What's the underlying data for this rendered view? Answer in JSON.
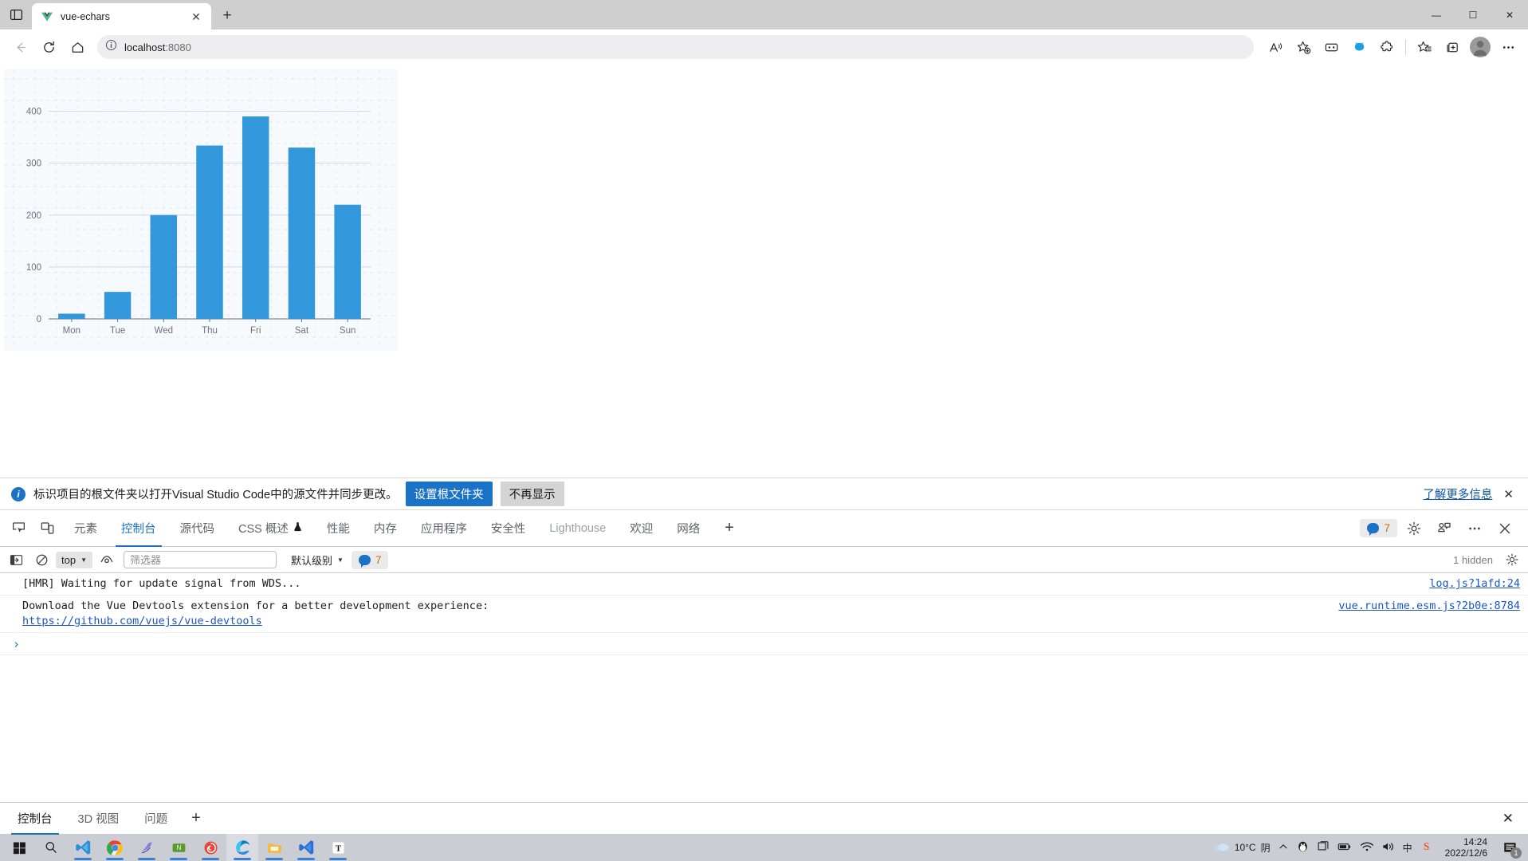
{
  "browser": {
    "tab": {
      "title": "vue-echars",
      "favicon": "vue-logo-icon",
      "close_label": "✕"
    },
    "new_tab_label": "+",
    "window_controls": {
      "minimize": "—",
      "maximize": "☐",
      "close": "✕"
    },
    "address": {
      "host": "localhost",
      "port": ":8080",
      "full": "localhost:8080"
    },
    "nav": {
      "back": "←",
      "refresh": "⟳",
      "home": "⌂"
    }
  },
  "chart_data": {
    "type": "bar",
    "title": "",
    "xlabel": "",
    "ylabel": "",
    "categories": [
      "Mon",
      "Tue",
      "Wed",
      "Thu",
      "Fri",
      "Sat",
      "Sun"
    ],
    "values": [
      10,
      52,
      200,
      334,
      390,
      330,
      220
    ],
    "ytick_labels": [
      "0",
      "100",
      "200",
      "300",
      "400"
    ],
    "yticks": [
      0,
      100,
      200,
      300,
      400
    ],
    "ylim": [
      0,
      450
    ],
    "grid": true,
    "legend": "none",
    "bar_color": "#3398db",
    "axis_color": "#333333",
    "gridline_color": "#ccdbe8",
    "selection_color": "#1fa391"
  },
  "notice": {
    "icon": "info-icon",
    "text": "标识项目的根文件夹以打开Visual Studio Code中的源文件并同步更改。",
    "primary_button": "设置根文件夹",
    "secondary_button": "不再显示",
    "learn_more": "了解更多信息",
    "close": "✕"
  },
  "devtools": {
    "tabs": [
      {
        "label": "元素",
        "active": false,
        "muted": false
      },
      {
        "label": "控制台",
        "active": true,
        "muted": false
      },
      {
        "label": "源代码",
        "active": false,
        "muted": false
      },
      {
        "label": "CSS 概述",
        "active": false,
        "muted": false,
        "badge": "flask-icon"
      },
      {
        "label": "性能",
        "active": false,
        "muted": false
      },
      {
        "label": "内存",
        "active": false,
        "muted": false
      },
      {
        "label": "应用程序",
        "active": false,
        "muted": false
      },
      {
        "label": "安全性",
        "active": false,
        "muted": false
      },
      {
        "label": "Lighthouse",
        "active": false,
        "muted": true
      },
      {
        "label": "欢迎",
        "active": false,
        "muted": false
      },
      {
        "label": "网络",
        "active": false,
        "muted": false
      }
    ],
    "add_tab_label": "+",
    "message_count": "7",
    "toolbar": {
      "context": "top",
      "filter_placeholder": "筛选器",
      "filter_value": "",
      "level": "默认级别",
      "badge_count": "7",
      "hidden_text": "1 hidden"
    },
    "console_logs": [
      {
        "text": "[HMR] Waiting for update signal from WDS...",
        "link": "",
        "source": "log.js?1afd:24"
      },
      {
        "text": "Download the Vue Devtools extension for a better development experience:",
        "link": "https://github.com/vuejs/vue-devtools",
        "source": "vue.runtime.esm.js?2b0e:8784"
      }
    ],
    "prompt_caret": "›",
    "drawer_tabs": [
      {
        "label": "控制台",
        "active": true
      },
      {
        "label": "3D 视图",
        "active": false
      },
      {
        "label": "问题",
        "active": false
      }
    ],
    "drawer_add_label": "+",
    "drawer_close": "✕"
  },
  "taskbar": {
    "items": [
      {
        "name": "start-button"
      },
      {
        "name": "search-button"
      },
      {
        "name": "vscode-insiders-icon"
      },
      {
        "name": "chrome-icon"
      },
      {
        "name": "navicat-icon"
      },
      {
        "name": "node-icon"
      },
      {
        "name": "redis-icon"
      },
      {
        "name": "edge-icon"
      },
      {
        "name": "file-explorer-icon"
      },
      {
        "name": "vscode-icon"
      },
      {
        "name": "typora-icon"
      }
    ],
    "tray": {
      "weather_temp": "10°C",
      "weather_desc": "阴",
      "time": "14:24",
      "date": "2022/12/6",
      "notification_count": "1",
      "ime": "中"
    }
  }
}
